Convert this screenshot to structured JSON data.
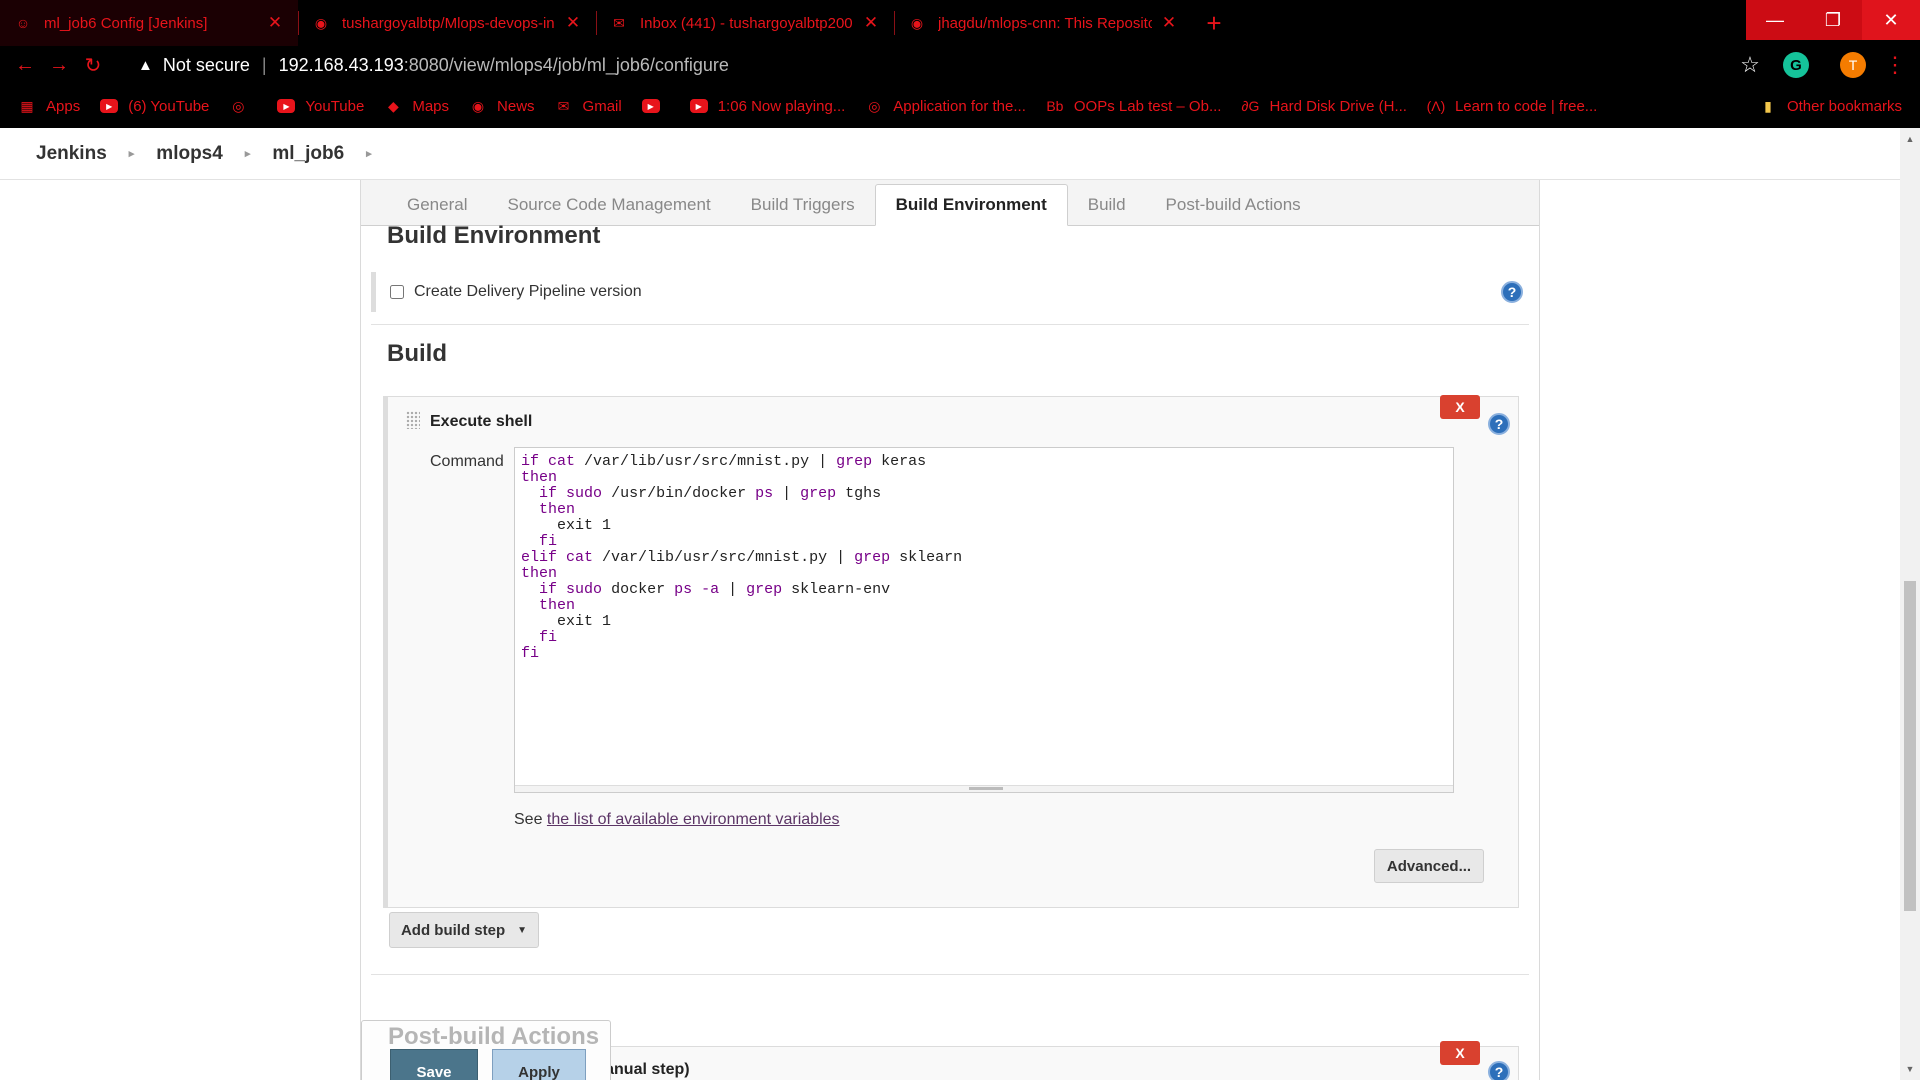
{
  "browser": {
    "tabs": [
      {
        "title": "ml_job6 Config [Jenkins]",
        "icon": "jenkins-icon",
        "active": true
      },
      {
        "title": "tushargoyalbtp/Mlops-devops-in",
        "icon": "github-icon",
        "active": false
      },
      {
        "title": "Inbox (441) - tushargoyalbtp200",
        "icon": "gmail-icon",
        "active": false
      },
      {
        "title": "jhagdu/mlops-cnn: This Reposito",
        "icon": "github-icon",
        "active": false
      }
    ],
    "security_label": "Not secure",
    "url_host": "192.168.43.193",
    "url_path": ":8080/view/mlops4/job/ml_job6/configure",
    "profile_initial": "T",
    "extension_initial": "G",
    "accent_color": "#e8141b"
  },
  "bookmarks": [
    {
      "label": "Apps",
      "icon": "apps-grid-icon"
    },
    {
      "label": "(6) YouTube",
      "icon": "youtube-icon"
    },
    {
      "label": "",
      "icon": "opera-icon"
    },
    {
      "label": "YouTube",
      "icon": "youtube-icon"
    },
    {
      "label": "Maps",
      "icon": "maps-icon"
    },
    {
      "label": "News",
      "icon": "news-icon"
    },
    {
      "label": "Gmail",
      "icon": "gmail-icon"
    },
    {
      "label": "",
      "icon": "youtube-icon"
    },
    {
      "label": "1:06 Now playing...",
      "icon": "youtube-icon"
    },
    {
      "label": "Application for the...",
      "icon": "opera-icon"
    },
    {
      "label": "OOPs Lab test – Ob...",
      "icon": "blackboard-icon"
    },
    {
      "label": "Hard Disk Drive (H...",
      "icon": "gfg-icon"
    },
    {
      "label": "Learn to code | free...",
      "icon": "freecodecamp-icon"
    }
  ],
  "other_bookmarks": "Other bookmarks",
  "breadcrumb": [
    "Jenkins",
    "mlops4",
    "ml_job6"
  ],
  "config_tabs": [
    "General",
    "Source Code Management",
    "Build Triggers",
    "Build Environment",
    "Build",
    "Post-build Actions"
  ],
  "build_environment": {
    "title": "Build Environment",
    "checkbox_label": "Create Delivery Pipeline version",
    "checked": false
  },
  "build": {
    "title": "Build",
    "step_title": "Execute shell",
    "command_label": "Command",
    "command": [
      "if cat /var/lib/usr/src/mnist.py | grep keras",
      "then",
      "  if sudo /usr/bin/docker ps | grep tghs",
      "  then",
      "    exit 1",
      "  fi",
      "elif cat /var/lib/usr/src/mnist.py | grep sklearn",
      "then",
      "  if sudo docker ps -a | grep sklearn-env",
      "  then",
      "    exit 1",
      "  fi",
      "fi"
    ],
    "see_text": "See ",
    "env_link": "the list of available environment variables",
    "advanced_label": "Advanced...",
    "add_step_label": "Add build step",
    "delete_label": "X"
  },
  "post_build": {
    "title": "Post-build Actions",
    "step_title": "Build other projects (manual step)"
  },
  "actions": {
    "save": "Save",
    "apply": "Apply"
  }
}
